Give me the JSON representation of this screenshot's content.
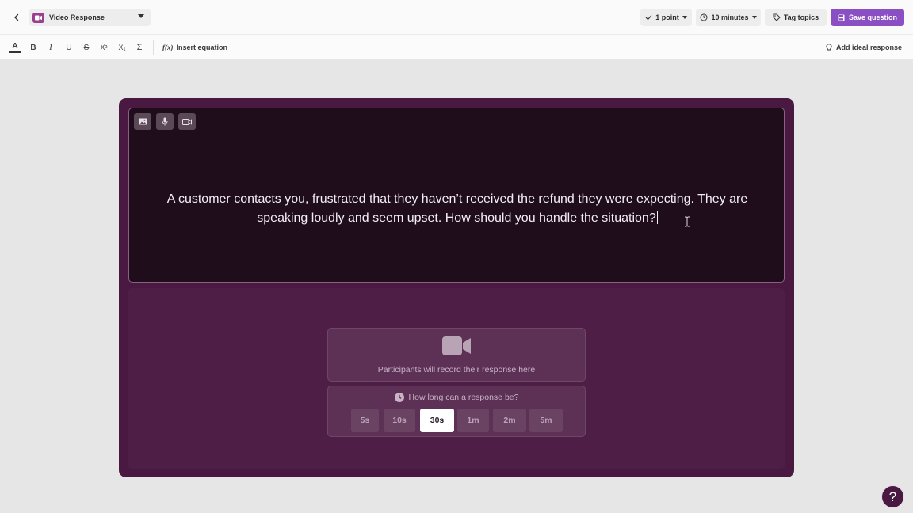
{
  "topbar": {
    "question_type": "Video Response",
    "points": "1 point",
    "duration": "10 minutes",
    "tag_topics": "Tag topics",
    "save": "Save question"
  },
  "toolbar": {
    "text_color": "A",
    "bold": "B",
    "italic": "I",
    "underline": "U",
    "strikethrough": "S",
    "superscript": "X²",
    "subscript": "X₁",
    "sum": "Σ",
    "insert_equation": "Insert equation",
    "equation_glyph": "f(x)",
    "add_ideal_response": "Add ideal response"
  },
  "question": {
    "line1": "A customer contacts you, frustrated that they haven’t received the refund they were expecting. They are",
    "line2": "speaking loudly and seem upset. How should you handle the situation?"
  },
  "response": {
    "record_text": "Participants will record their response here",
    "duration_question": "How long can a response be?",
    "options": [
      "5s",
      "10s",
      "30s",
      "1m",
      "2m",
      "5m"
    ],
    "selected": "30s"
  },
  "help": "?",
  "colors": {
    "accent": "#8b4fc4",
    "card": "#4a1942",
    "question_bg": "#1f0d1c",
    "type_badge": "#9a3f8f"
  }
}
